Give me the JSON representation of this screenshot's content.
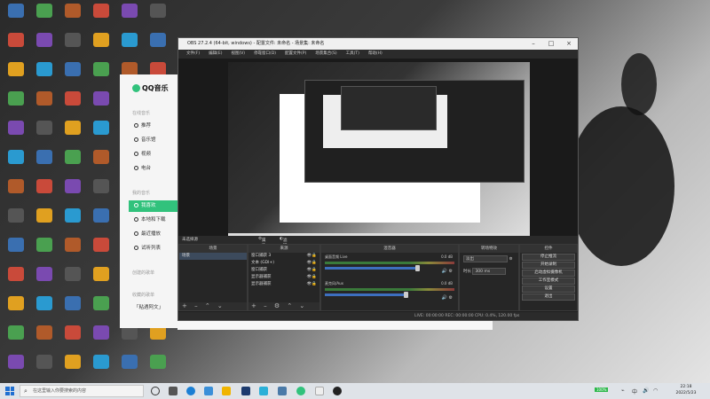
{
  "obs": {
    "title": "OBS 27.2.4 (64-bit, windows) - 配置文件: 未命名 - 场景集: 未命名",
    "menu": [
      "文件(F)",
      "编辑(E)",
      "视图(V)",
      "停靠窗口(D)",
      "配置文件(P)",
      "场景集合(S)",
      "工具(T)",
      "帮助(H)"
    ],
    "scene_tabs": {
      "left": "未选择源",
      "props": "属性",
      "filters": "滤镜"
    },
    "docks": {
      "scenes": {
        "title": "场景",
        "items": [
          "场景"
        ]
      },
      "sources": {
        "title": "来源",
        "items": [
          "窗口捕获 3",
          "文本 (GDI+)",
          "窗口捕获",
          "显示器捕获",
          "显示器捕获"
        ]
      },
      "mixer": {
        "title": "混音器",
        "channels": [
          {
            "name": "桌面音频 Live",
            "db": "0.0 dB",
            "level": 0.8
          },
          {
            "name": "麦克风/Aux",
            "db": "0.0 dB",
            "level": 0.7
          }
        ]
      },
      "transitions": {
        "title": "转场特效",
        "value": "淡出",
        "duration_label": "时长",
        "duration": "300 ms"
      },
      "controls": {
        "title": "控件",
        "buttons": [
          "停止推流",
          "开始录制",
          "启动虚拟摄像机",
          "工作室模式",
          "设置",
          "退出"
        ]
      }
    },
    "status": "LIVE: 00:00:00   REC: 00:00:00   CPU: 0.4%, 120.00 fps"
  },
  "qq_music": {
    "logo": "QQ音乐",
    "section_online": "在线音乐",
    "online_items": [
      "推荐",
      "音乐馆",
      "视频",
      "电台"
    ],
    "section_mine": "我的音乐",
    "mine_items": [
      "我喜欢",
      "本地和下载",
      "最近播放",
      "试听列表"
    ],
    "section_created": "创建的歌单",
    "section_fav": "收藏的歌单",
    "fav_items": [
      "「粘遇阿文」"
    ],
    "accent": "#31c27c"
  },
  "taskbar": {
    "search_placeholder": "在这里输入你要搜索的内容",
    "time": "22:18",
    "date": "2022/5/23"
  }
}
